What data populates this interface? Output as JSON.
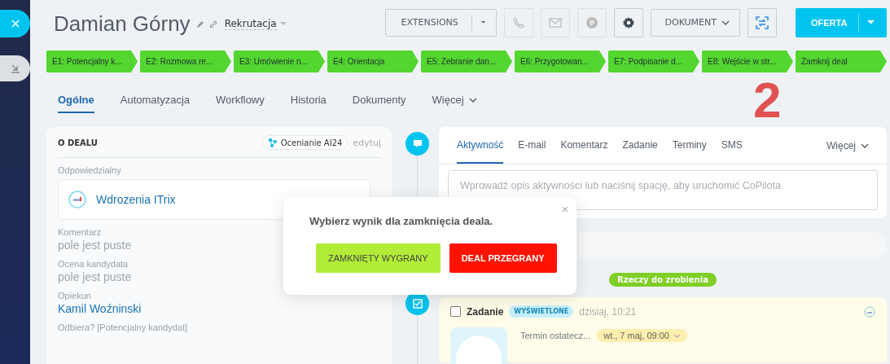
{
  "header": {
    "title": "Damian Górny",
    "pipeline": "Rekrutacja"
  },
  "toolbar": {
    "extensions": "EXTENSIONS",
    "document": "DOKUMENT",
    "offer": "OFERTA"
  },
  "stages": [
    {
      "label": "E1: Potencjalny k..."
    },
    {
      "label": "E2: Rozmowa re..."
    },
    {
      "label": "E3: Umówienie n..."
    },
    {
      "label": "E4: Orientacja"
    },
    {
      "label": "E5: Zebranie dan..."
    },
    {
      "label": "E6: Przygotowan..."
    },
    {
      "label": "E7: Podpisanie d..."
    },
    {
      "label": "E8: Wejście w str..."
    },
    {
      "label": "Zamknij deal"
    }
  ],
  "tabs": [
    {
      "label": "Ogólne",
      "selected": true
    },
    {
      "label": "Automatyzacja",
      "selected": false
    },
    {
      "label": "Workflowy",
      "selected": false
    },
    {
      "label": "Historia",
      "selected": false
    },
    {
      "label": "Dokumenty",
      "selected": false
    },
    {
      "label": "Więcej",
      "selected": false,
      "dropdown": true
    }
  ],
  "deal_card": {
    "heading": "O DEALU",
    "ai_badge": "Ocenianie AI24",
    "edit": "edytuj",
    "fields": [
      {
        "kind": "user",
        "label": "Odpowiedzialny",
        "value": "Wdrozenia ITrix"
      },
      {
        "kind": "empty",
        "label": "Komentarz",
        "value": "pole jest puste"
      },
      {
        "kind": "empty",
        "label": "Ocena kandydata",
        "value": "pole jest puste"
      },
      {
        "kind": "link",
        "label": "Opiekun",
        "value": "Kamil Woźninski"
      },
      {
        "kind": "label",
        "label": "Odbiera? [Potencjalny kandydat]"
      }
    ]
  },
  "activity": {
    "tabs": [
      {
        "label": "Aktywność",
        "selected": true
      },
      {
        "label": "E-mail",
        "selected": false
      },
      {
        "label": "Komentarz",
        "selected": false
      },
      {
        "label": "Zadanie",
        "selected": false
      },
      {
        "label": "Terminy",
        "selected": false
      },
      {
        "label": "SMS",
        "selected": false
      }
    ],
    "more": "Więcej",
    "placeholder": "Wprowadź opis aktywności lub naciśnij spację, aby uruchomić CoPilota"
  },
  "todo_label": "Rzeczy do zrobienia",
  "task": {
    "checked": false,
    "title": "Zadanie",
    "badge": "WYŚWIETLONE",
    "time": "dzisiaj, 10:21",
    "deadline_label": "Termin ostatecz...",
    "deadline": "wt., 7 maj, 09:00"
  },
  "popup": {
    "message": "Wybierz wynik dla zamknięcia deala.",
    "close": "×",
    "buttons": [
      {
        "kind": "win",
        "label": "ZAMKNIĘTY WYGRANY"
      },
      {
        "kind": "lose",
        "label": "DEAL PRZEGRANY"
      }
    ]
  },
  "annotation": "2"
}
